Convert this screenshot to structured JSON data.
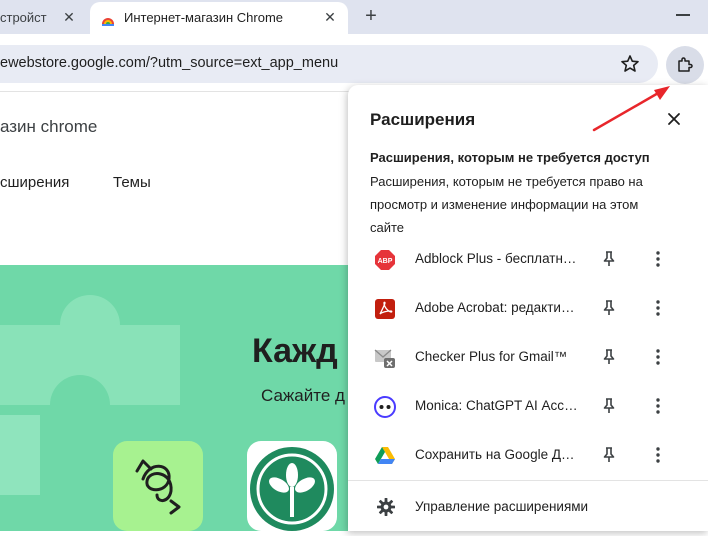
{
  "tabs": {
    "prev_tab_title": "стройст",
    "active_tab_title": "Интернет-магазин Chrome"
  },
  "address_bar": {
    "url": "ewebstore.google.com/?utm_source=ext_app_menu"
  },
  "page": {
    "store_title": "азин chrome",
    "nav_extensions": "сширения",
    "nav_themes": "Темы",
    "hero_heading": "Кажд",
    "hero_subtitle": "Сажайте д"
  },
  "extensions_popup": {
    "title": "Расширения",
    "section_heading": "Расширения, которым не требуется доступ",
    "section_description": "Расширения, которым не требуется право на просмотр и изменение информации на этом сайте",
    "items": [
      {
        "name": "Adblock Plus - бесплатный блокировщик рекламы",
        "icon": "abp-icon",
        "icon_text": "ABP",
        "icon_color": "#e6343a"
      },
      {
        "name": "Adobe Acrobat: редактирование PDF",
        "icon": "adobe-acrobat-icon",
        "icon_color": "#c21f0e"
      },
      {
        "name": "Checker Plus for Gmail™",
        "icon": "checker-plus-icon",
        "icon_color": "#8a8a8a"
      },
      {
        "name": "Monica: ChatGPT AI Ассистент",
        "icon": "monica-icon",
        "icon_color": "#4a3bff"
      },
      {
        "name": "Сохранить на Google Диске",
        "icon": "google-drive-icon"
      }
    ],
    "manage_label": "Управление расширениями"
  },
  "colors": {
    "hero_background": "#6fd8a8",
    "annotation_arrow": "#e8262b"
  }
}
